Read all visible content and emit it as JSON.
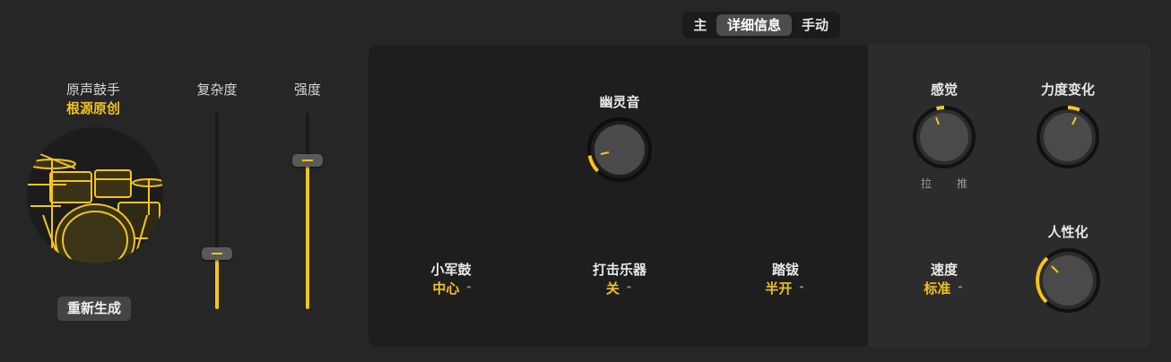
{
  "tabs": [
    {
      "label": "主",
      "active": false
    },
    {
      "label": "详细信息",
      "active": true
    },
    {
      "label": "手动",
      "active": false
    }
  ],
  "drummer": {
    "title": "原声鼓手",
    "name": "根源原创",
    "regenerate_label": "重新生成"
  },
  "sliders": {
    "complexity": {
      "label": "复杂度",
      "value": 0.28
    },
    "intensity": {
      "label": "强度",
      "value": 0.75
    }
  },
  "knobs": {
    "ghost_notes": {
      "label": "幽灵音",
      "value": 0.12
    },
    "feel": {
      "label": "感觉",
      "value": 0.45,
      "left_label": "拉",
      "right_label": "推"
    },
    "dynamics": {
      "label": "力度变化",
      "value": 0.58
    },
    "humanize": {
      "label": "人性化",
      "value": 0.3
    }
  },
  "selectors": {
    "snare": {
      "label": "小军鼓",
      "value": "中心"
    },
    "percussion": {
      "label": "打击乐器",
      "value": "关"
    },
    "hihat": {
      "label": "踏钹",
      "value": "半开"
    },
    "speed": {
      "label": "速度",
      "value": "标准"
    }
  },
  "colors": {
    "accent": "#f5c518",
    "background": "#262626",
    "panel": "#1e1e1e",
    "panel_right": "#2c2c2c"
  },
  "icons": {
    "drum_kit": "drum-kit-icon",
    "chevron": "chevron-up-down-icon"
  }
}
